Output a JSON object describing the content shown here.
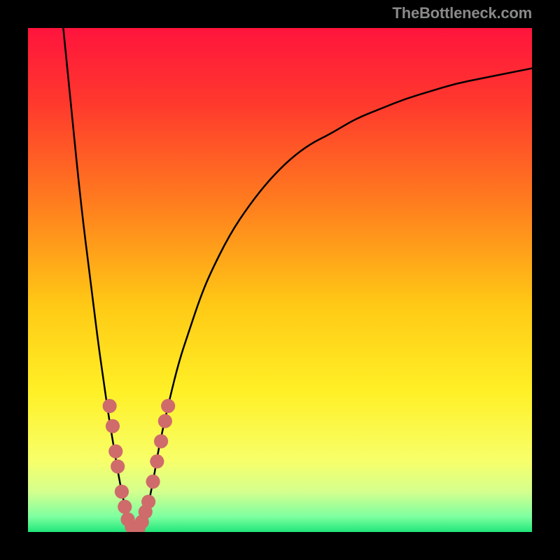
{
  "watermark": "TheBottleneck.com",
  "chart_data": {
    "type": "line",
    "title": "",
    "xlabel": "",
    "ylabel": "",
    "xlim": [
      0,
      100
    ],
    "ylim": [
      0,
      100
    ],
    "background_gradient": {
      "stops": [
        {
          "offset": 0.0,
          "color": "#ff143d"
        },
        {
          "offset": 0.15,
          "color": "#ff392d"
        },
        {
          "offset": 0.35,
          "color": "#ff7e1e"
        },
        {
          "offset": 0.55,
          "color": "#ffc915"
        },
        {
          "offset": 0.72,
          "color": "#fff026"
        },
        {
          "offset": 0.86,
          "color": "#f7ff6a"
        },
        {
          "offset": 0.92,
          "color": "#d4ff8e"
        },
        {
          "offset": 0.97,
          "color": "#7dffa0"
        },
        {
          "offset": 1.0,
          "color": "#20e67a"
        }
      ]
    },
    "series": [
      {
        "name": "bottleneck-curve",
        "x": [
          7,
          8,
          9,
          10,
          11,
          12,
          13,
          14,
          15,
          16,
          17,
          18,
          19,
          20,
          21,
          22,
          23,
          24,
          25,
          26,
          28,
          30,
          32,
          34,
          36,
          40,
          44,
          48,
          52,
          56,
          60,
          65,
          70,
          75,
          80,
          85,
          90,
          95,
          100
        ],
        "y": [
          100,
          90,
          80,
          70,
          61,
          53,
          45,
          37,
          30,
          23,
          17,
          11,
          6,
          2,
          0,
          0,
          2,
          6,
          11,
          17,
          26,
          34,
          40,
          46,
          51,
          59,
          65,
          70,
          74,
          77,
          79,
          82,
          84,
          86,
          87.5,
          89,
          90,
          91,
          92
        ]
      }
    ],
    "markers": {
      "name": "data-points",
      "color": "#cf6b6b",
      "radius": 1.4,
      "points": [
        {
          "x": 16.2,
          "y": 25
        },
        {
          "x": 16.8,
          "y": 21
        },
        {
          "x": 17.4,
          "y": 16
        },
        {
          "x": 17.8,
          "y": 13
        },
        {
          "x": 18.6,
          "y": 8
        },
        {
          "x": 19.2,
          "y": 5
        },
        {
          "x": 19.8,
          "y": 2.5
        },
        {
          "x": 20.6,
          "y": 1
        },
        {
          "x": 21.2,
          "y": 0.5
        },
        {
          "x": 21.9,
          "y": 0.7
        },
        {
          "x": 22.6,
          "y": 2
        },
        {
          "x": 23.3,
          "y": 4
        },
        {
          "x": 23.9,
          "y": 6
        },
        {
          "x": 24.8,
          "y": 10
        },
        {
          "x": 25.6,
          "y": 14
        },
        {
          "x": 26.4,
          "y": 18
        },
        {
          "x": 27.2,
          "y": 22
        },
        {
          "x": 27.8,
          "y": 25
        }
      ]
    }
  }
}
